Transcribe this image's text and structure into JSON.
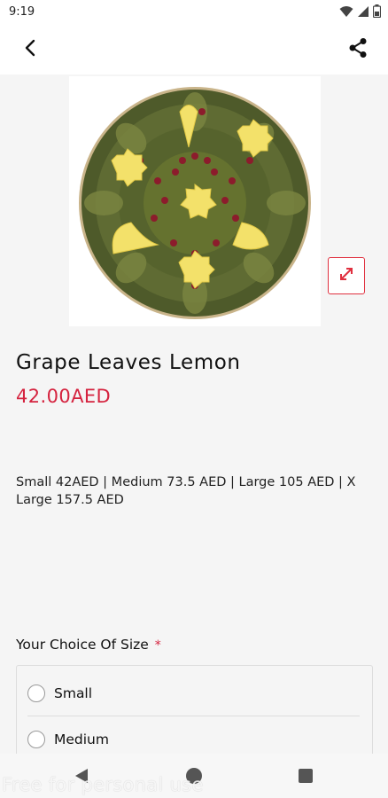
{
  "status_bar": {
    "time": "9:19",
    "icons": [
      "wifi-icon",
      "signal-icon",
      "battery-icon"
    ]
  },
  "app_bar": {
    "back_icon": "back-arrow-icon",
    "share_icon": "share-icon"
  },
  "product": {
    "image_alt": "Grape leaves platter",
    "expand_icon": "expand-icon",
    "title": "Grape Leaves Lemon",
    "price": "42.00AED",
    "description": "Small 42AED | Medium 73.5 AED | Large 105 AED | X Large 157.5 AED"
  },
  "options": {
    "title": "Your Choice Of Size",
    "required_mark": "*",
    "items": [
      {
        "label": "Small"
      },
      {
        "label": "Medium"
      }
    ]
  },
  "watermark": "Free for personal use",
  "colors": {
    "accent": "#d5233f",
    "background": "#f5f5f5"
  }
}
